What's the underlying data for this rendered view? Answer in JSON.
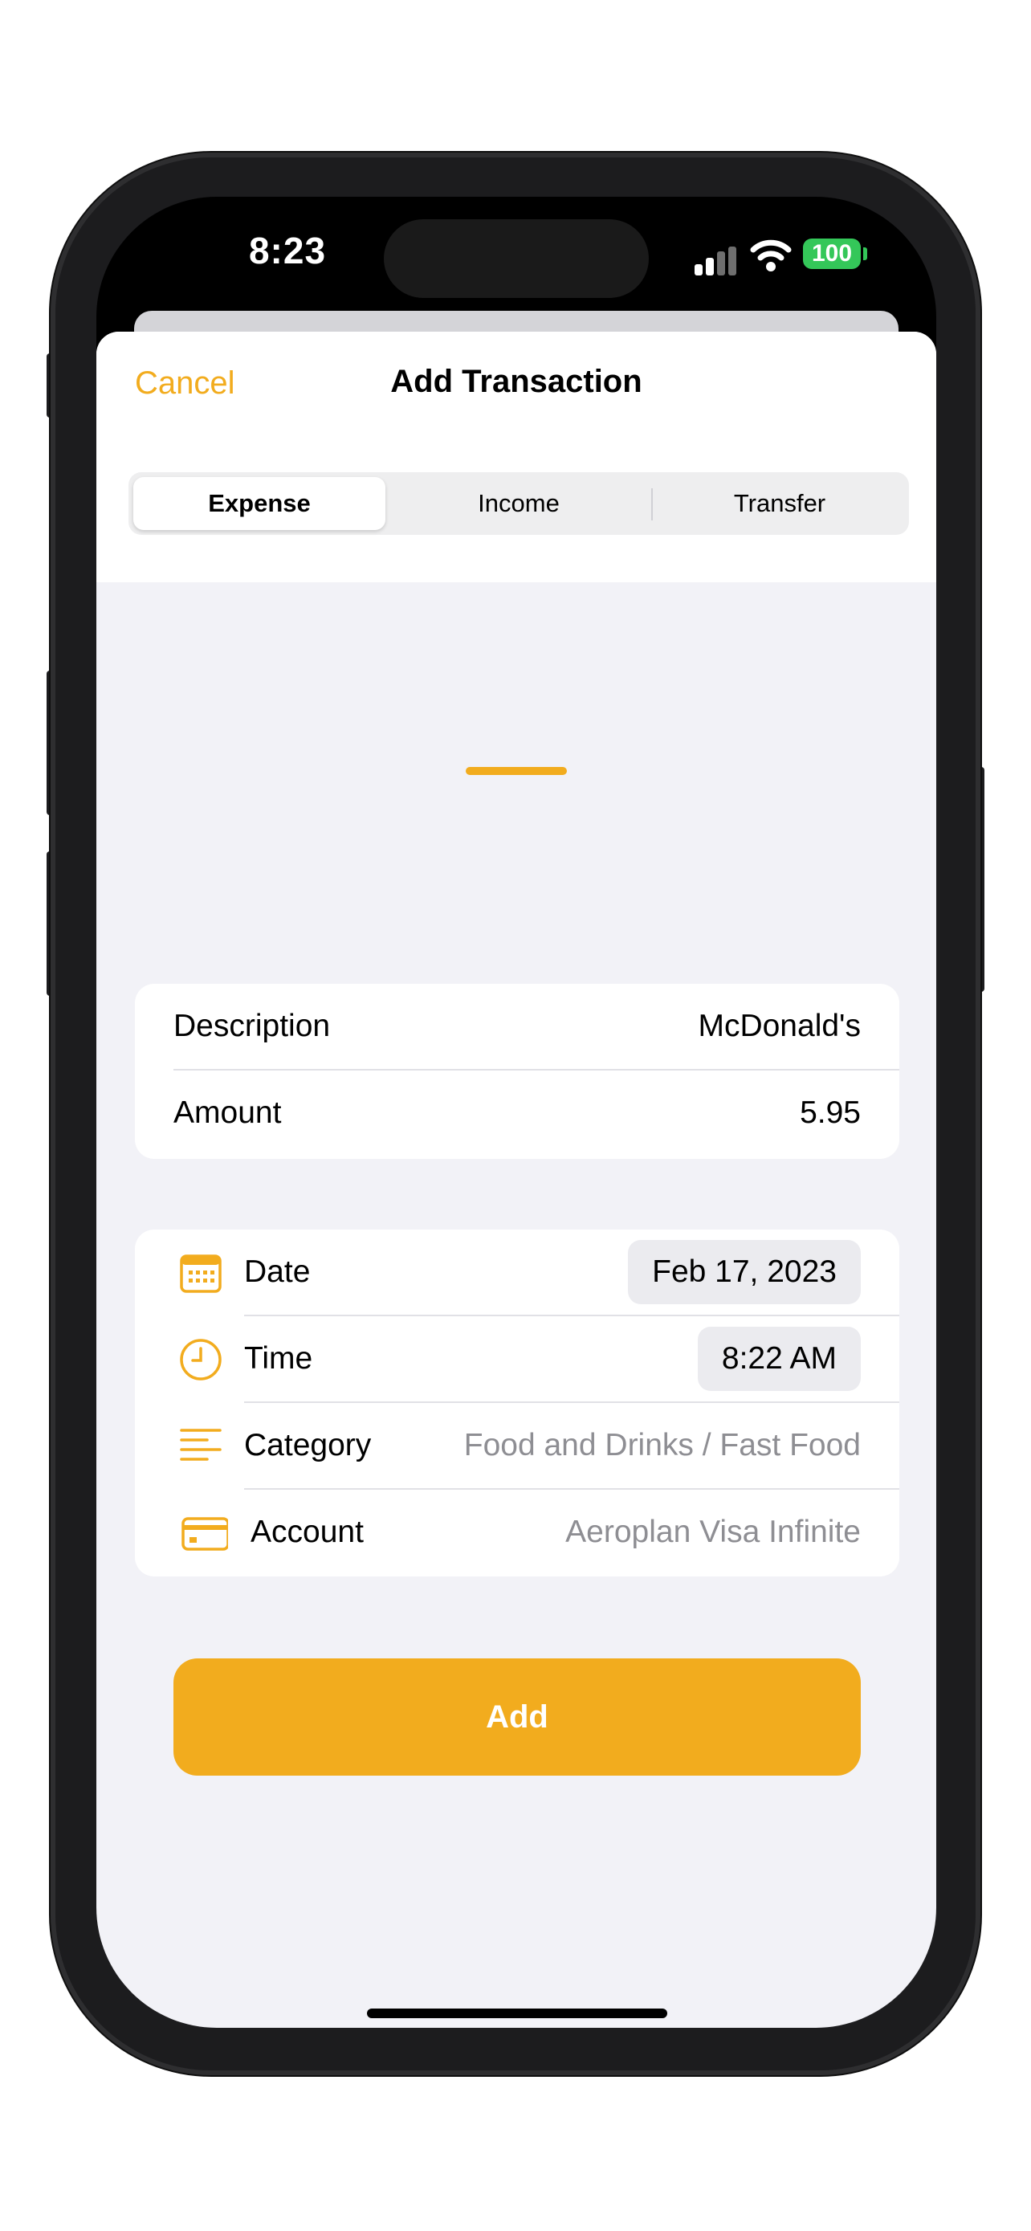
{
  "status_bar": {
    "time": "8:23",
    "battery": "100"
  },
  "header": {
    "cancel_label": "Cancel",
    "title": "Add Transaction"
  },
  "segments": {
    "items": [
      "Expense",
      "Income",
      "Transfer"
    ],
    "selected": "Expense"
  },
  "details": {
    "description_label": "Description",
    "description_value": "McDonald's",
    "amount_label": "Amount",
    "amount_value": "5.95"
  },
  "meta": {
    "date_label": "Date",
    "date_value": "Feb 17, 2023",
    "time_label": "Time",
    "time_value": "8:22 AM",
    "category_label": "Category",
    "category_value": "Food and Drinks / Fast Food",
    "account_label": "Account",
    "account_value": "Aeroplan Visa Infinite"
  },
  "actions": {
    "add_label": "Add"
  },
  "colors": {
    "accent": "#f2ac1e",
    "background": "#f2f2f7",
    "battery": "#34c759"
  }
}
